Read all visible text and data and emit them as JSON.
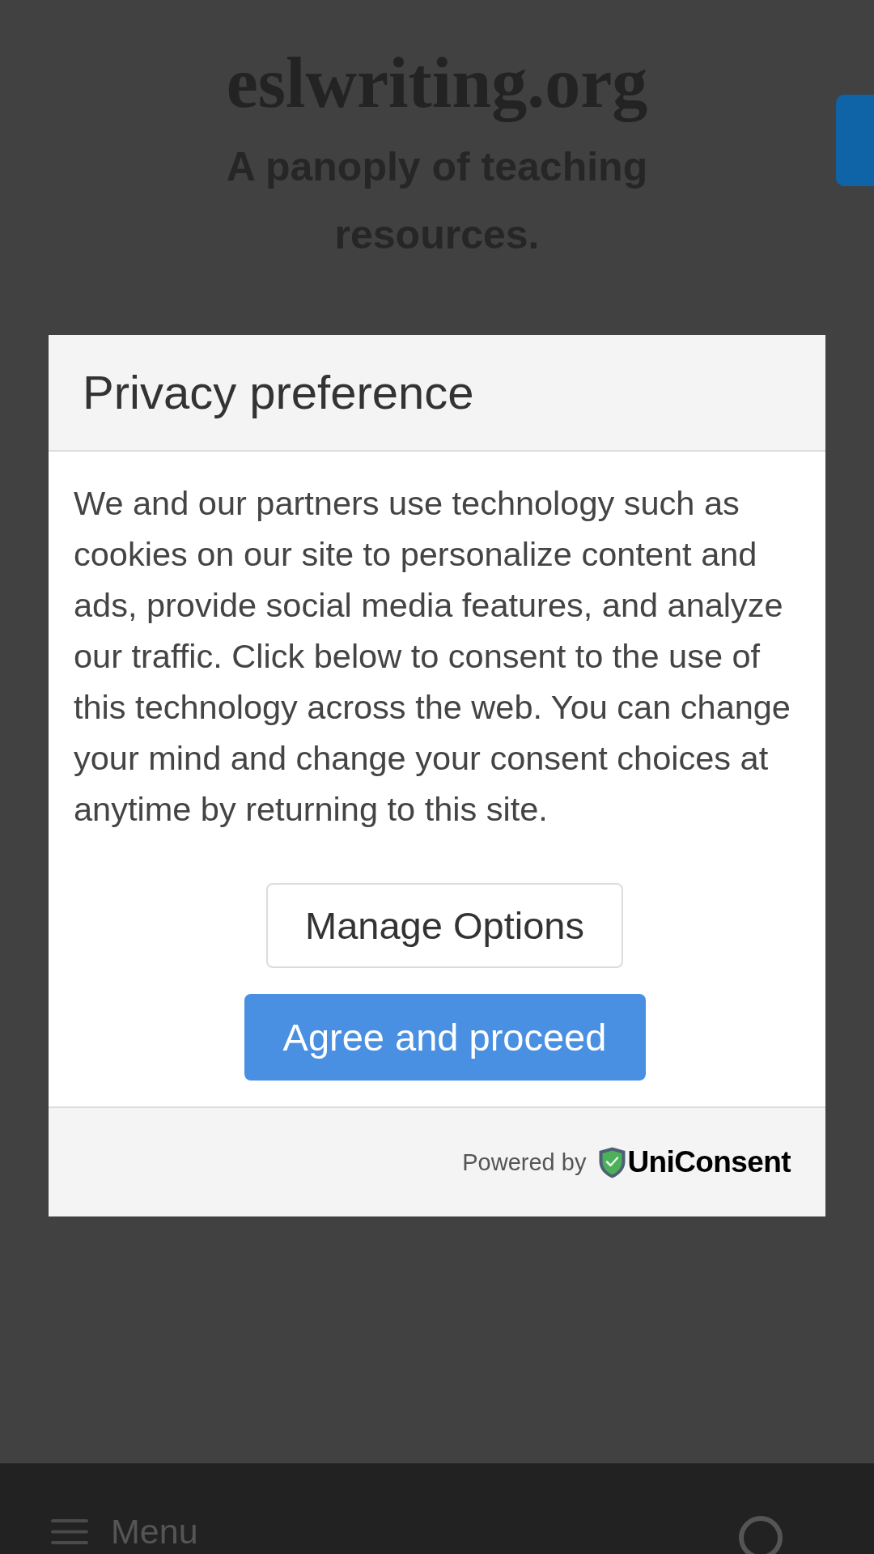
{
  "site": {
    "title": "eslwriting.org",
    "tagline": "A panoply of teaching resources."
  },
  "consent_dialog": {
    "title": "Privacy preference",
    "message": "We and our partners use technology such as cookies on our site to personalize content and ads, provide social media features, and analyze our traffic. Click below to consent to the use of this technology across the web. You can change your mind and change your consent choices at anytime by returning to this site.",
    "buttons": [
      {
        "label": "Manage Options",
        "kind": "secondary"
      },
      {
        "label": "Agree and proceed",
        "kind": "primary"
      }
    ],
    "footer": {
      "powered_by": "Powered by",
      "brand": "UniConsent"
    }
  },
  "bottom_bar": {
    "menu_label": "Menu"
  }
}
